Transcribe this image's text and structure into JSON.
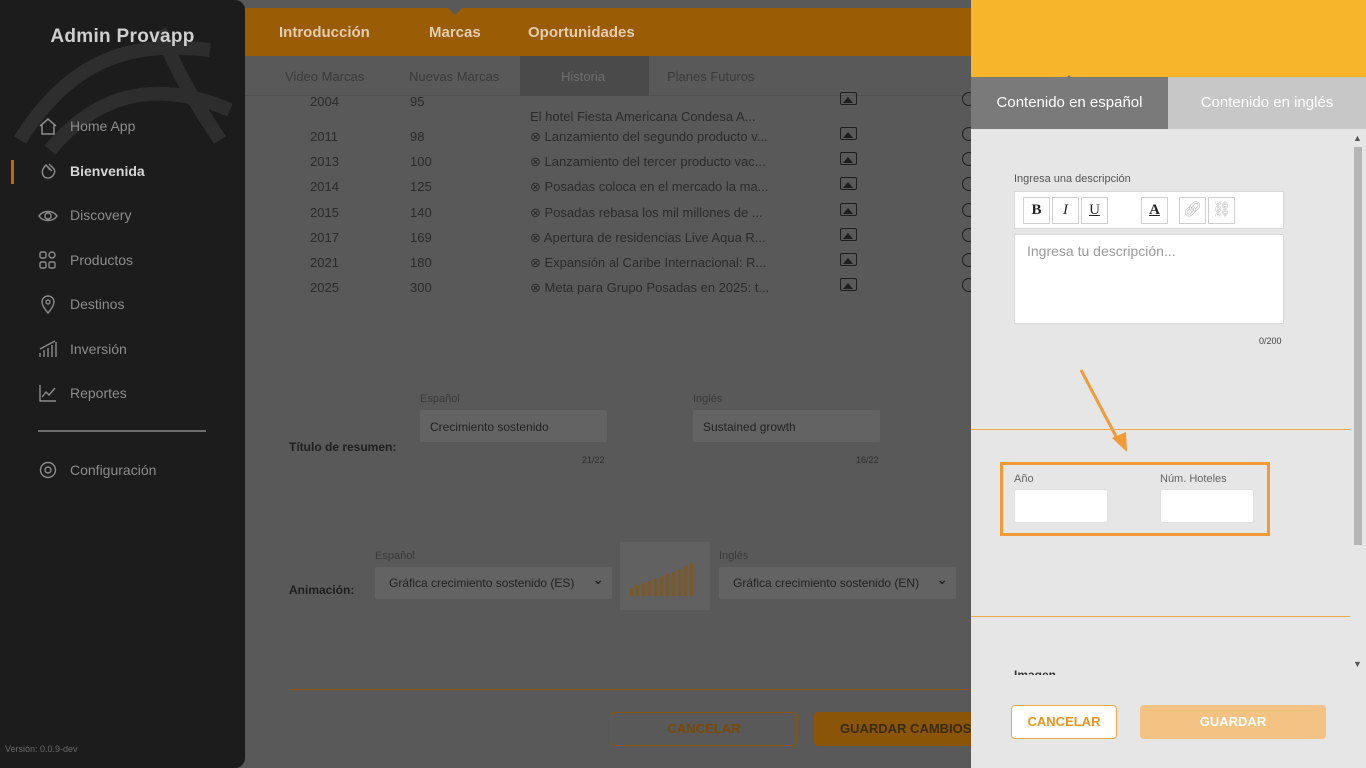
{
  "app": {
    "title": "Admin Provapp",
    "version": "Versión: 0.0.9-dev"
  },
  "sidebar": {
    "items": [
      {
        "label": "Home App",
        "icon": "home-icon"
      },
      {
        "label": "Bienvenida",
        "icon": "wave-hand-icon",
        "active": true
      },
      {
        "label": "Discovery",
        "icon": "eye-icon"
      },
      {
        "label": "Productos",
        "icon": "grid-icon"
      },
      {
        "label": "Destinos",
        "icon": "location-pin-icon"
      },
      {
        "label": "Inversión",
        "icon": "bar-growth-icon"
      },
      {
        "label": "Reportes",
        "icon": "line-chart-icon"
      },
      {
        "label": "Configuración",
        "icon": "gear-icon"
      }
    ]
  },
  "top_tabs": [
    "Introducción",
    "Marcas",
    "Oportunidades"
  ],
  "sub_tabs": [
    "Video Marcas",
    "Nuevas Marcas",
    "Historia",
    "Planes Futuros"
  ],
  "history": {
    "rows": [
      {
        "year": "2004",
        "num": "95",
        "desc": "El hotel Fiesta Americana Condesa A..."
      },
      {
        "year": "2011",
        "num": "98",
        "desc": "⊗ Lanzamiento del segundo producto v..."
      },
      {
        "year": "2013",
        "num": "100",
        "desc": "⊗ Lanzamiento del tercer producto vac..."
      },
      {
        "year": "2014",
        "num": "125",
        "desc": "⊗ Posadas coloca en el mercado la ma..."
      },
      {
        "year": "2015",
        "num": "140",
        "desc": "⊗ Posadas rebasa los mil millones de ..."
      },
      {
        "year": "2017",
        "num": "169",
        "desc": "⊗ Apertura de residencias Live Aqua R..."
      },
      {
        "year": "2021",
        "num": "180",
        "desc": "⊗ Expansión al Caribe Internacional: R..."
      },
      {
        "year": "2025",
        "num": "300",
        "desc": "⊗ Meta para Grupo Posadas en 2025: t..."
      }
    ]
  },
  "summary": {
    "label": "Título de resumen:",
    "es_label": "Español",
    "en_label": "Inglés",
    "es_value": "Crecimiento sostenido",
    "en_value": "Sustained growth",
    "es_count": "21/22",
    "en_count": "16/22"
  },
  "animation": {
    "label": "Animación:",
    "es_label": "Español",
    "en_label": "Inglés",
    "es_value": "Gráfica crecimiento sostenido (ES)",
    "en_value": "Gráfica crecimiento sostenido (EN)"
  },
  "main_buttons": {
    "cancel": "CANCELAR",
    "save": "GUARDAR CAMBIOS"
  },
  "panel": {
    "tab_es": "Contenido en español",
    "tab_en": "Contenido en inglés",
    "desc_label": "Ingresa una descripción",
    "desc_placeholder": "Ingresa tu descripción...",
    "desc_count": "0/200",
    "toolbar": {
      "bold": "B",
      "italic": "I",
      "underline": "U",
      "color": "A"
    },
    "year_label": "Año",
    "hotels_label": "Núm. Hoteles",
    "image_label": "Imagen",
    "cancel": "CANCELAR",
    "save": "GUARDAR"
  },
  "colors": {
    "accent": "#f6b52b",
    "highlight": "#f29a35",
    "sidebar": "#1c1c1c"
  }
}
